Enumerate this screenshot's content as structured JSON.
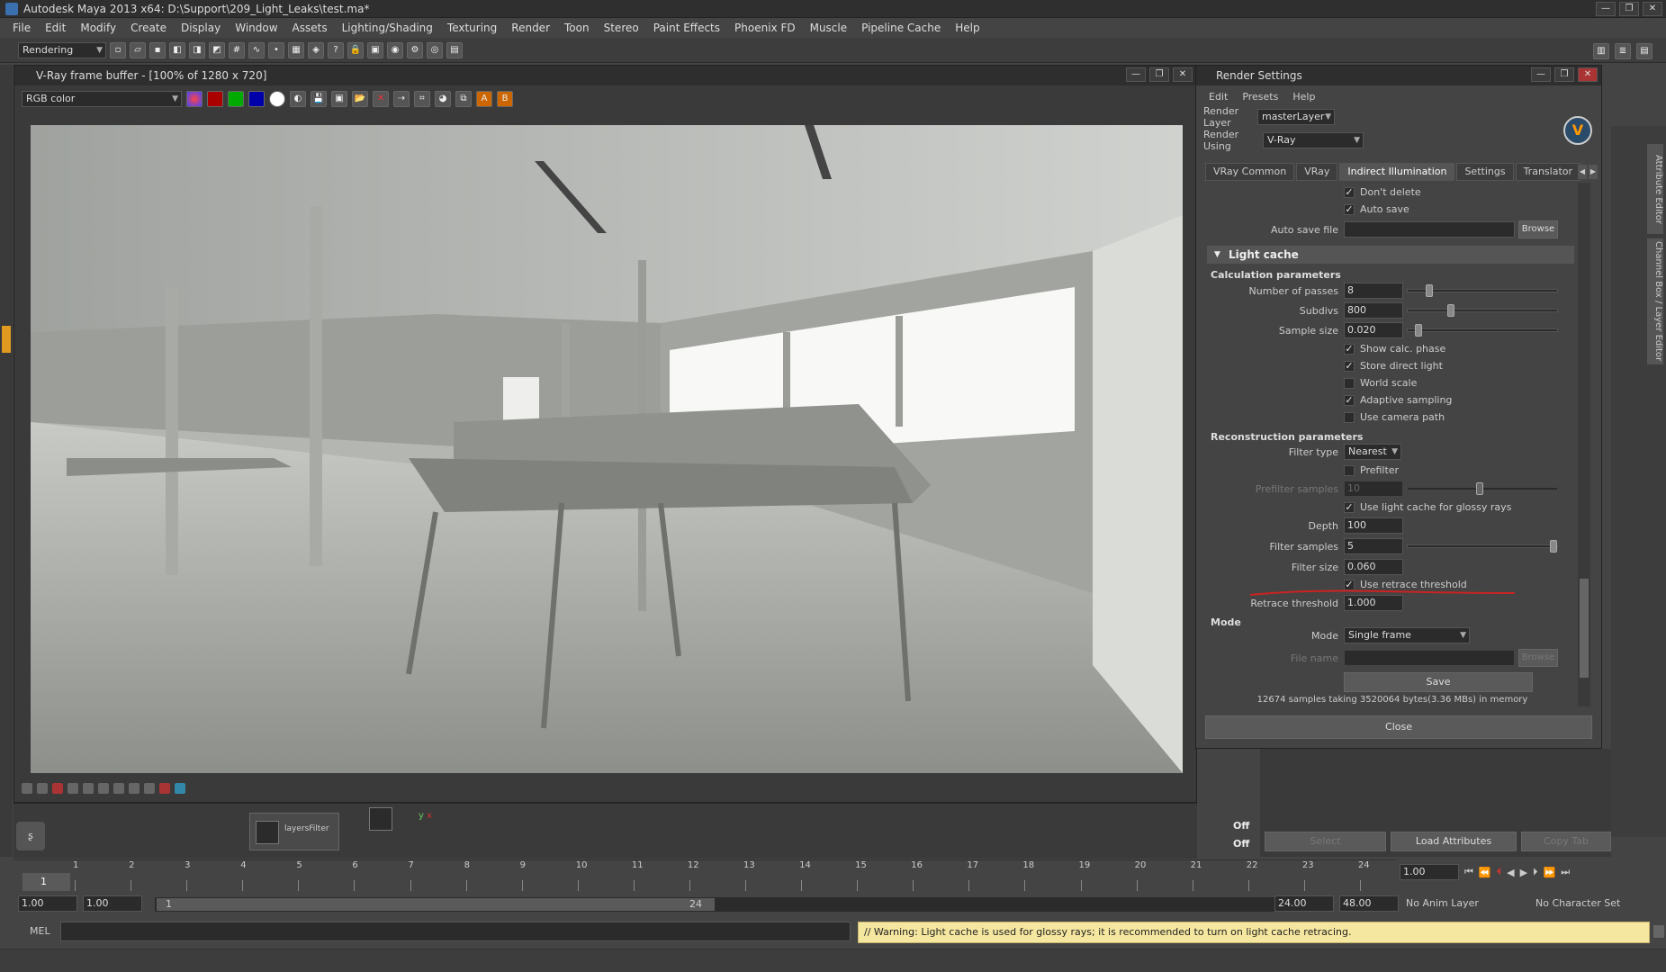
{
  "window": {
    "title": "Autodesk Maya 2013 x64: D:\\Support\\209_Light_Leaks\\test.ma*"
  },
  "menu": [
    "File",
    "Edit",
    "Modify",
    "Create",
    "Display",
    "Window",
    "Assets",
    "Lighting/Shading",
    "Texturing",
    "Render",
    "Toon",
    "Stereo",
    "Paint Effects",
    "Phoenix FD",
    "Muscle",
    "Pipeline Cache",
    "Help"
  ],
  "shelf": {
    "mode": "Rendering"
  },
  "vfb": {
    "title": "V-Ray frame buffer - [100% of 1280 x 720]",
    "channel": "RGB color"
  },
  "render_settings": {
    "title": "Render Settings",
    "menu": [
      "Edit",
      "Presets",
      "Help"
    ],
    "render_layer_label": "Render Layer",
    "render_layer_value": "masterLayer",
    "render_using_label": "Render Using",
    "render_using_value": "V-Ray",
    "tabs": [
      "VRay Common",
      "VRay",
      "Indirect Illumination",
      "Settings",
      "Translator"
    ],
    "active_tab": "Indirect Illumination",
    "dont_delete": "Don't delete",
    "auto_save": "Auto save",
    "auto_save_file_label": "Auto save file",
    "browse": "Browse",
    "section_light_cache": "Light cache",
    "calc_params": "Calculation parameters",
    "num_passes_label": "Number of passes",
    "num_passes": "8",
    "subdivs_label": "Subdivs",
    "subdivs": "800",
    "sample_size_label": "Sample size",
    "sample_size": "0.020",
    "show_calc": "Show calc. phase",
    "store_direct": "Store direct light",
    "world_scale": "World scale",
    "adaptive": "Adaptive sampling",
    "camera_path": "Use camera path",
    "recon_params": "Reconstruction parameters",
    "filter_type_label": "Filter type",
    "filter_type": "Nearest",
    "prefilter": "Prefilter",
    "prefilter_samples_label": "Prefilter samples",
    "prefilter_samples": "10",
    "use_lc_glossy": "Use light cache for glossy rays",
    "depth_label": "Depth",
    "depth": "100",
    "filter_samples_label": "Filter samples",
    "filter_samples": "5",
    "filter_size_label": "Filter size",
    "filter_size": "0.060",
    "use_retrace": "Use retrace threshold",
    "retrace_label": "Retrace threshold",
    "retrace": "1.000",
    "mode_h": "Mode",
    "mode_label": "Mode",
    "mode_value": "Single frame",
    "file_name_label": "File name",
    "save": "Save",
    "memory_info": "12674 samples taking 3520064 bytes(3.36 MBs) in memory",
    "close": "Close"
  },
  "right_panel": {
    "side_tabs": [
      "Attribute Editor",
      "Channel Box / Layer Editor"
    ],
    "select": "Select",
    "load_attributes": "Load Attributes",
    "copy_tab": "Copy Tab",
    "off1": "Off",
    "off2": "Off"
  },
  "outliner_node": "layersFilter",
  "timeline": {
    "ticks": [
      "1",
      "2",
      "3",
      "4",
      "5",
      "6",
      "7",
      "8",
      "9",
      "10",
      "11",
      "12",
      "13",
      "14",
      "15",
      "16",
      "17",
      "18",
      "19",
      "20",
      "21",
      "22",
      "23",
      "24"
    ],
    "current": "1",
    "current_field": "1.00"
  },
  "range": {
    "start": "1.00",
    "start2": "1.00",
    "slider_start": "1",
    "slider_end": "24",
    "end": "24.00",
    "end2": "48.00",
    "anim_layer": "No Anim Layer",
    "char_set": "No Character Set"
  },
  "cmd": {
    "label": "MEL",
    "warning": "// Warning: Light cache is used for glossy rays; it is recommended to turn on light cache retracing."
  },
  "colors": {
    "accent_warning": "#f5e7a0",
    "annotation": "#cc2222"
  }
}
